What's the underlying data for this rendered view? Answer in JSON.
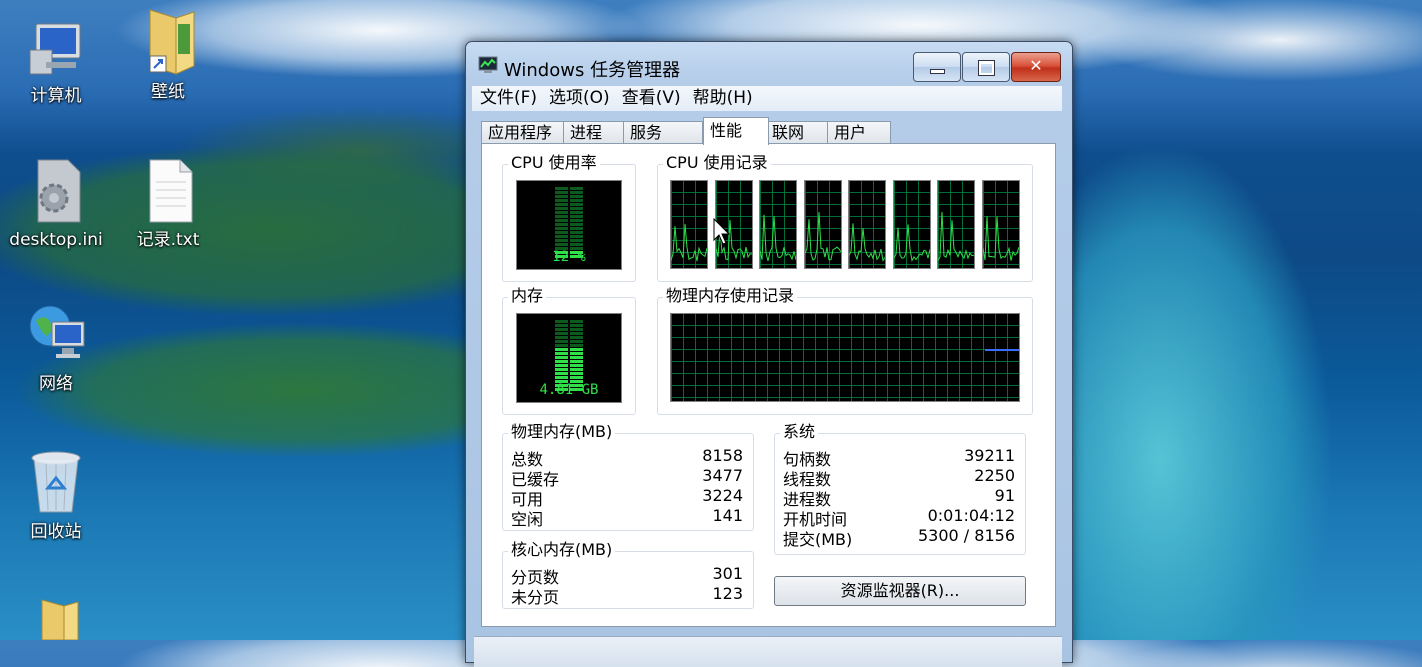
{
  "desktop": {
    "icons": [
      {
        "label": "计算机",
        "icon": "computer-icon"
      },
      {
        "label": "壁纸",
        "icon": "folder-shortcut-icon"
      },
      {
        "label": "desktop.ini",
        "icon": "settings-file-icon"
      },
      {
        "label": "记录.txt",
        "icon": "text-file-icon"
      },
      {
        "label": "网络",
        "icon": "network-icon"
      },
      {
        "label": "回收站",
        "icon": "recycle-bin-icon"
      },
      {
        "label": "",
        "icon": "folder-icon"
      }
    ]
  },
  "window": {
    "title": "Windows 任务管理器",
    "menu": [
      "文件(F)",
      "选项(O)",
      "查看(V)",
      "帮助(H)"
    ],
    "tabs": [
      "应用程序",
      "进程",
      "服务",
      "性能",
      "联网",
      "用户"
    ],
    "active_tab": "性能"
  },
  "performance": {
    "cpu_usage": {
      "title": "CPU 使用率",
      "value": "12 %",
      "level": 0.12
    },
    "cpu_history": {
      "title": "CPU 使用记录",
      "cores": 8
    },
    "memory": {
      "title": "内存",
      "value": "4.81 GB",
      "level": 0.6
    },
    "memory_history": {
      "title": "物理内存使用记录"
    },
    "physical_memory": {
      "title": "物理内存(MB)",
      "rows": [
        {
          "k": "总数",
          "v": "8158"
        },
        {
          "k": "已缓存",
          "v": "3477"
        },
        {
          "k": "可用",
          "v": "3224"
        },
        {
          "k": "空闲",
          "v": "141"
        }
      ]
    },
    "kernel_memory": {
      "title": "核心内存(MB)",
      "rows": [
        {
          "k": "分页数",
          "v": "301"
        },
        {
          "k": "未分页",
          "v": "123"
        }
      ]
    },
    "system": {
      "title": "系统",
      "rows": [
        {
          "k": "句柄数",
          "v": "39211"
        },
        {
          "k": "线程数",
          "v": "2250"
        },
        {
          "k": "进程数",
          "v": "91"
        },
        {
          "k": "开机时间",
          "v": "0:01:04:12"
        },
        {
          "k": "提交(MB)",
          "v": "5300 / 8156"
        }
      ]
    },
    "resmon_button": "资源监视器(R)..."
  },
  "colors": {
    "graph_green": "#2fe048",
    "grid": "#008040",
    "memory_line": "#3a6cff"
  }
}
